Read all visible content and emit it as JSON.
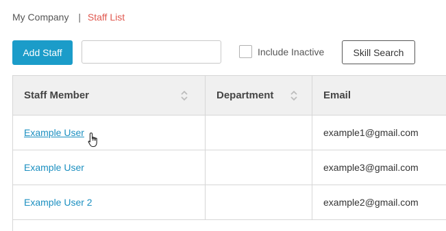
{
  "breadcrumb": {
    "parent": "My Company",
    "separator": "|",
    "current": "Staff List"
  },
  "toolbar": {
    "add_label": "Add Staff",
    "search_value": "",
    "include_inactive_label": "Include Inactive",
    "include_inactive_checked": false,
    "skill_search_label": "Skill Search"
  },
  "table": {
    "columns": [
      "Staff Member",
      "Department",
      "Email"
    ],
    "rows": [
      {
        "name": "Example User",
        "department": "",
        "email": "example1@gmail.com"
      },
      {
        "name": "Example User",
        "department": "",
        "email": "example3@gmail.com"
      },
      {
        "name": "Example User 2",
        "department": "",
        "email": "example2@gmail.com"
      }
    ]
  },
  "colors": {
    "accent": "#1b9cc9",
    "breadcrumb_current": "#e0584f",
    "link": "#1b8fc0"
  },
  "icons": {
    "sort": "sort-updown-icon",
    "cursor": "hand-pointer-icon"
  }
}
